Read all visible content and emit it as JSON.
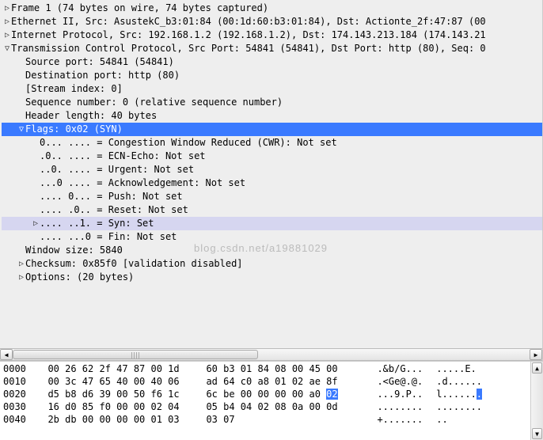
{
  "tree": {
    "r0": "Frame 1 (74 bytes on wire, 74 bytes captured)",
    "r1": "Ethernet II, Src: AsustekC_b3:01:84 (00:1d:60:b3:01:84), Dst: Actionte_2f:47:87 (00",
    "r2": "Internet Protocol, Src: 192.168.1.2 (192.168.1.2), Dst: 174.143.213.184 (174.143.21",
    "r3": "Transmission Control Protocol, Src Port: 54841 (54841), Dst Port: http (80), Seq: 0",
    "r4": "Source port: 54841 (54841)",
    "r5": "Destination port: http (80)",
    "r6": "[Stream index: 0]",
    "r7": "Sequence number: 0    (relative sequence number)",
    "r8": "Header length: 40 bytes",
    "r9": "Flags: 0x02 (SYN)",
    "r10": "0... .... = Congestion Window Reduced (CWR): Not set",
    "r11": ".0.. .... = ECN-Echo: Not set",
    "r12": "..0. .... = Urgent: Not set",
    "r13": "...0 .... = Acknowledgement: Not set",
    "r14": ".... 0... = Push: Not set",
    "r15": ".... .0.. = Reset: Not set",
    "r16": ".... ..1. = Syn: Set",
    "r17": ".... ...0 = Fin: Not set",
    "r18": "Window size: 5840",
    "r19": "Checksum: 0x85f0 [validation disabled]",
    "r20": "Options: (20 bytes)"
  },
  "arrows": {
    "right": "▷",
    "down": "▽",
    "rightsmall": "▷"
  },
  "watermark": "blog.csdn.net/a19881029",
  "hex": [
    {
      "off": "0000",
      "b1": "00 26 62 2f 47 87 00 1d",
      "b2": "60 b3 01 84 08 00 45 00",
      "a1": ".&b/G...",
      "a2": " .....E."
    },
    {
      "off": "0010",
      "b1": "00 3c 47 65 40 00 40 06",
      "b2": "ad 64 c0 a8 01 02 ae 8f",
      "a1": ".<Ge@.@.",
      "a2": " .d......"
    },
    {
      "off": "0020",
      "b1": "d5 b8 d6 39 00 50 f6 1c",
      "b2": "6c be 00 00 00 00 a0 ",
      "b2hl": "02",
      "a1": "...9.P..",
      "a2": " l......",
      ".": "hl2"
    },
    {
      "off": "0030",
      "b1": "16 d0 85 f0 00 00 02 04",
      "b2": "05 b4 04 02 08 0a 00 0d",
      "a1": "........",
      "a2": " ........"
    },
    {
      "off": "0040",
      "b1": "2b db 00 00 00 00 01 03",
      "b2": "03 07",
      "a1": "+.......",
      "a2": " .."
    }
  ]
}
